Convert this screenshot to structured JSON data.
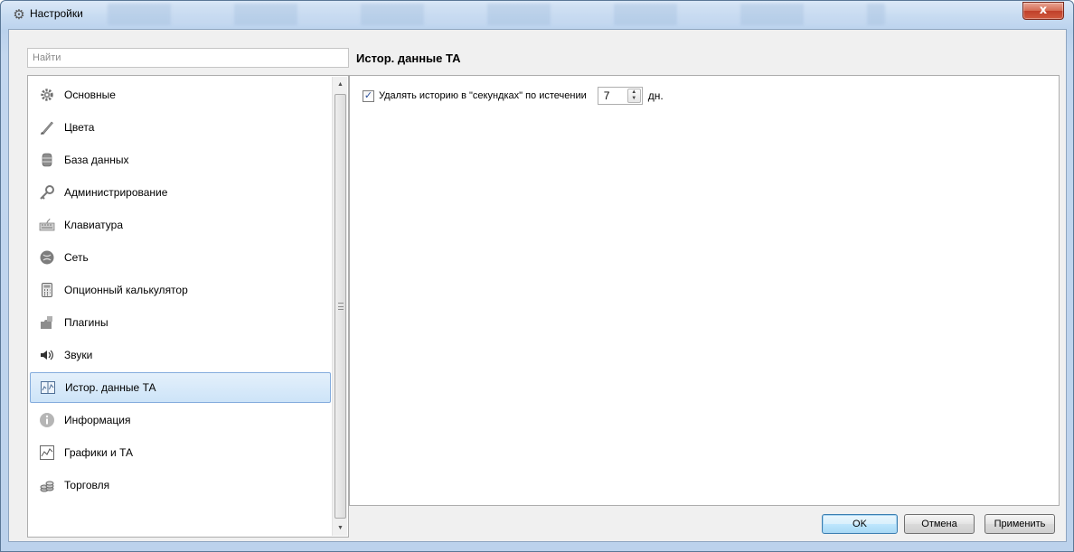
{
  "window": {
    "title": "Настройки",
    "close_glyph": "x",
    "accent": "#84acdd"
  },
  "search": {
    "placeholder": "Найти",
    "value": ""
  },
  "sidebar": {
    "items": [
      {
        "label": "Основные",
        "icon": "gear-icon"
      },
      {
        "label": "Цвета",
        "icon": "brush-icon"
      },
      {
        "label": "База данных",
        "icon": "database-icon"
      },
      {
        "label": "Администрирование",
        "icon": "key-icon"
      },
      {
        "label": "Клавиатура",
        "icon": "keyboard-icon"
      },
      {
        "label": "Сеть",
        "icon": "network-icon"
      },
      {
        "label": "Опционный калькулятор",
        "icon": "calculator-icon"
      },
      {
        "label": "Плагины",
        "icon": "puzzle-icon"
      },
      {
        "label": "Звуки",
        "icon": "speaker-icon"
      },
      {
        "label": "Истор. данные ТА",
        "icon": "chart-book-icon",
        "selected": true
      },
      {
        "label": "Информация",
        "icon": "info-icon"
      },
      {
        "label": "Графики и ТА",
        "icon": "line-chart-icon"
      },
      {
        "label": "Торговля",
        "icon": "coins-icon"
      }
    ]
  },
  "main": {
    "title": "Истор. данные ТА",
    "option": {
      "checked": true,
      "label": "Удалять историю в \"секундках\" по истечении",
      "value": "7",
      "unit": "дн."
    }
  },
  "footer": {
    "ok_label": "OK",
    "cancel_label": "Отмена",
    "apply_label": "Применить"
  }
}
